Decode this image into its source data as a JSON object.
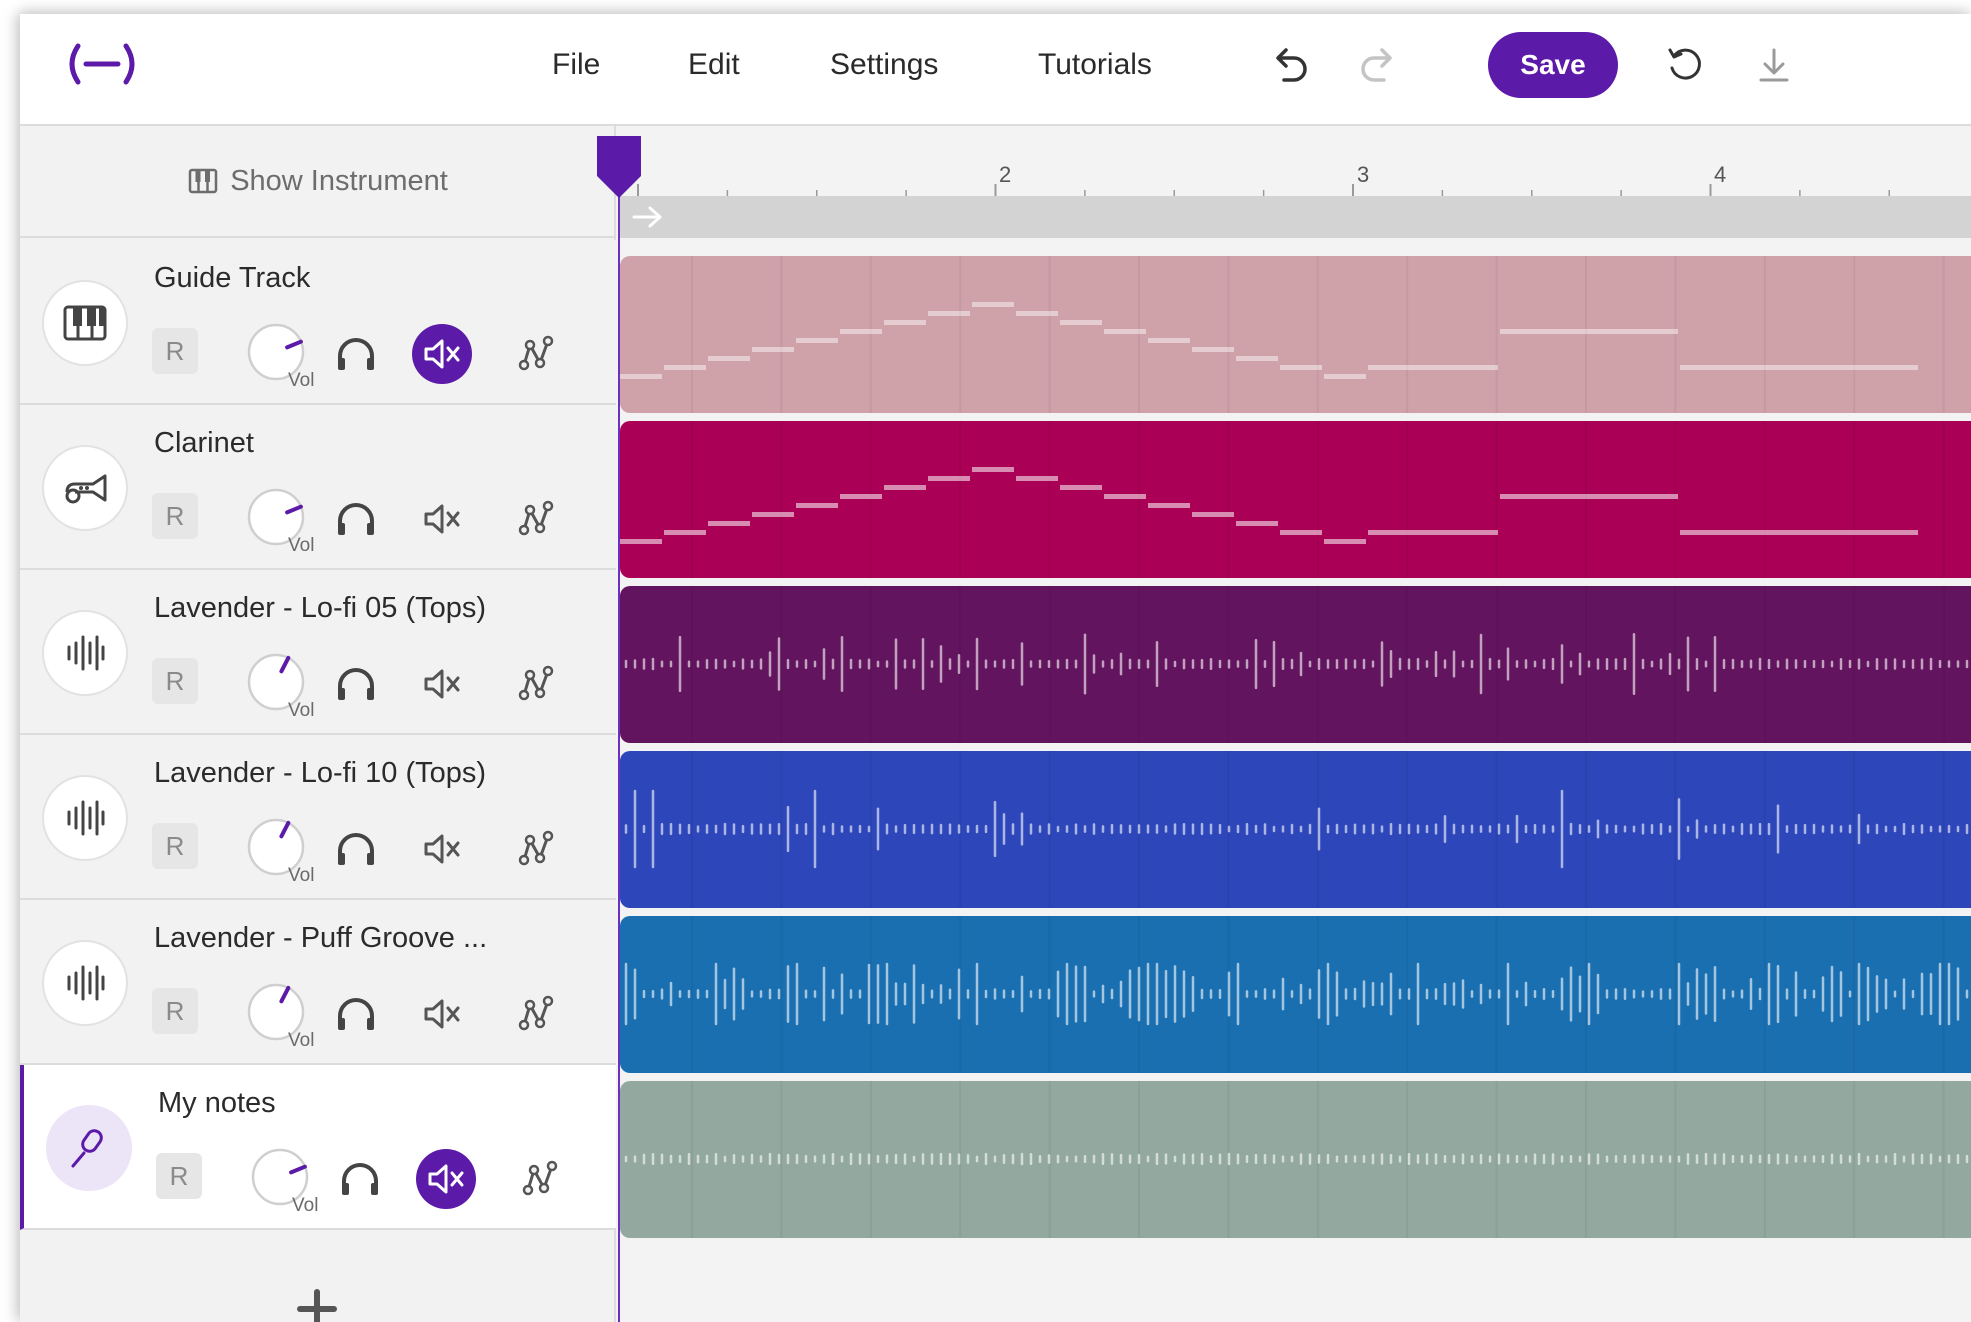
{
  "menu": {
    "file": "File",
    "edit": "Edit",
    "settings": "Settings",
    "tutorials": "Tutorials"
  },
  "toolbar": {
    "save_label": "Save",
    "icons": [
      "undo-icon",
      "redo-icon",
      "history-icon",
      "download-icon"
    ]
  },
  "show_instrument_label": "Show Instrument",
  "vol_label": "Vol",
  "rec_label": "R",
  "tracks": [
    {
      "name": "Guide Track",
      "icon": "piano-keys-icon",
      "color": "#cfa2a9",
      "type": "midi",
      "muted": true,
      "volume": 0.75
    },
    {
      "name": "Clarinet",
      "icon": "clarinet-icon",
      "color": "#aa0055",
      "type": "midi",
      "muted": false,
      "volume": 0.75
    },
    {
      "name": "Lavender - Lo-fi 05 (Tops)",
      "icon": "waveform-icon",
      "color": "#62145e",
      "type": "audio",
      "muted": false,
      "volume": 0.6
    },
    {
      "name": "Lavender - Lo-fi 10 (Tops)",
      "icon": "waveform-icon",
      "color": "#2d46b9",
      "type": "audio",
      "muted": false,
      "volume": 0.6
    },
    {
      "name": "Lavender - Puff Groove ...",
      "icon": "waveform-icon",
      "color": "#1a6fb0",
      "type": "audio",
      "muted": false,
      "volume": 0.6
    },
    {
      "name": "My notes",
      "icon": "microphone-icon",
      "color": "#93a9a0",
      "type": "audio",
      "muted": true,
      "volume": 0.75,
      "selected": true
    }
  ],
  "ruler": {
    "bars": [
      "2",
      "3",
      "4"
    ]
  },
  "colors": {
    "accent": "#5b1aa8",
    "playhead": "#6b2fc4"
  }
}
